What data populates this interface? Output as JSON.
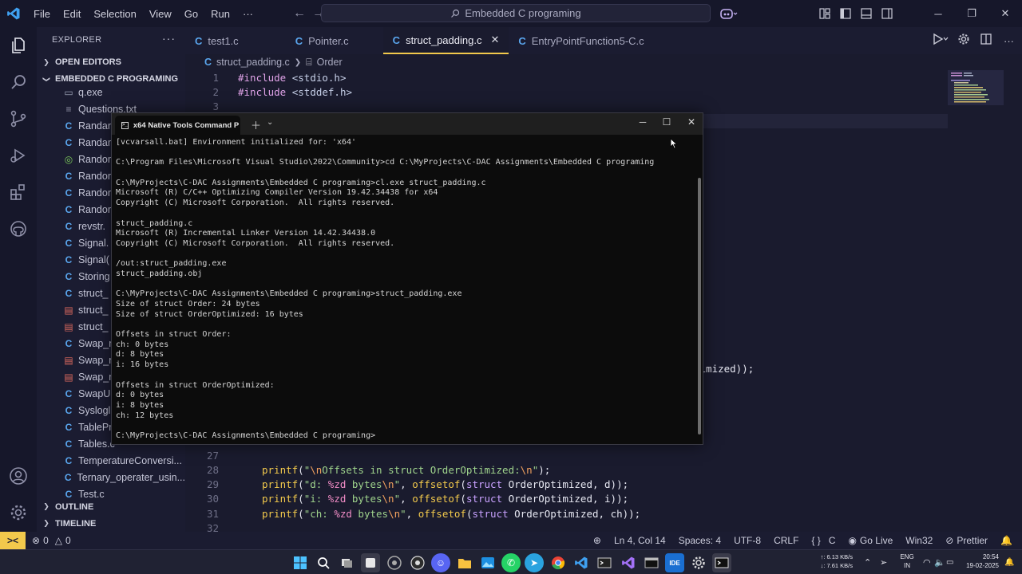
{
  "menu": [
    "File",
    "Edit",
    "Selection",
    "View",
    "Go",
    "Run",
    "···"
  ],
  "search": "Embedded C programing",
  "explorer": {
    "title": "EXPLORER",
    "open_editors": "OPEN EDITORS",
    "folder": "EMBEDDED C PROGRAMING",
    "files": [
      {
        "name": "q.exe",
        "kind": "exe"
      },
      {
        "name": "Questions.txt",
        "kind": "txt"
      },
      {
        "name": "Randar",
        "kind": "c"
      },
      {
        "name": "Randar",
        "kind": "c"
      },
      {
        "name": "Randor",
        "kind": "green"
      },
      {
        "name": "Randor",
        "kind": "c"
      },
      {
        "name": "Randor",
        "kind": "c"
      },
      {
        "name": "Randor",
        "kind": "c"
      },
      {
        "name": "revstr.",
        "kind": "c"
      },
      {
        "name": "Signal.",
        "kind": "c"
      },
      {
        "name": "Signal(",
        "kind": "c"
      },
      {
        "name": "Storing",
        "kind": "c"
      },
      {
        "name": "struct_",
        "kind": "c"
      },
      {
        "name": "struct_",
        "kind": "red"
      },
      {
        "name": "struct_",
        "kind": "red"
      },
      {
        "name": "Swap_n",
        "kind": "c"
      },
      {
        "name": "Swap_n",
        "kind": "red"
      },
      {
        "name": "Swap_n",
        "kind": "red"
      },
      {
        "name": "SwapU",
        "kind": "c"
      },
      {
        "name": "Syslogl",
        "kind": "c"
      },
      {
        "name": "TablePr",
        "kind": "c"
      },
      {
        "name": "Tables.c",
        "kind": "c"
      },
      {
        "name": "TemperatureConversi...",
        "kind": "c"
      },
      {
        "name": "Ternary_operater_usin...",
        "kind": "c"
      },
      {
        "name": "Test.c",
        "kind": "c"
      }
    ],
    "outline": "OUTLINE",
    "timeline": "TIMELINE"
  },
  "tabs": [
    {
      "label": "test1.c",
      "active": false
    },
    {
      "label": "Pointer.c",
      "active": false
    },
    {
      "label": "struct_padding.c",
      "active": true
    },
    {
      "label": "EntryPointFunction5-C.c",
      "active": false
    }
  ],
  "breadcrumb": {
    "file": "struct_padding.c",
    "symbol": "Order"
  },
  "code_top": {
    "l1": "1",
    "l2": "2",
    "l3": "3",
    "inc1": "#include",
    "hdr1": "<stdio.h>",
    "inc2": "#include",
    "hdr2": "<stddef.h>"
  },
  "code_partial": "timized));",
  "code_bottom": {
    "l27": "27",
    "l28": "28",
    "l29": "29",
    "l30": "30",
    "l31": "31",
    "l32": "32"
  },
  "terminal": {
    "tab_title": "x64 Native Tools Command P",
    "lines": [
      "[vcvarsall.bat] Environment initialized for: 'x64'",
      "",
      "C:\\Program Files\\Microsoft Visual Studio\\2022\\Community>cd C:\\MyProjects\\C-DAC Assignments\\Embedded C programing",
      "",
      "C:\\MyProjects\\C-DAC Assignments\\Embedded C programing>cl.exe struct_padding.c",
      "Microsoft (R) C/C++ Optimizing Compiler Version 19.42.34438 for x64",
      "Copyright (C) Microsoft Corporation.  All rights reserved.",
      "",
      "struct_padding.c",
      "Microsoft (R) Incremental Linker Version 14.42.34438.0",
      "Copyright (C) Microsoft Corporation.  All rights reserved.",
      "",
      "/out:struct_padding.exe",
      "struct_padding.obj",
      "",
      "C:\\MyProjects\\C-DAC Assignments\\Embedded C programing>struct_padding.exe",
      "Size of struct Order: 24 bytes",
      "Size of struct OrderOptimized: 16 bytes",
      "",
      "Offsets in struct Order:",
      "ch: 0 bytes",
      "d: 8 bytes",
      "i: 16 bytes",
      "",
      "Offsets in struct OrderOptimized:",
      "d: 0 bytes",
      "i: 8 bytes",
      "ch: 12 bytes",
      "",
      "C:\\MyProjects\\C-DAC Assignments\\Embedded C programing>"
    ]
  },
  "status": {
    "remote": "><",
    "errors": "0",
    "warnings": "0",
    "position": "Ln 4, Col 14",
    "spaces": "Spaces: 4",
    "encoding": "UTF-8",
    "eol": "CRLF",
    "braces": "{ }",
    "language": "C",
    "golive": "Go Live",
    "platform": "Win32",
    "prettier": "Prettier"
  },
  "taskbar": {
    "net_up": "↑: 6.13 KB/s",
    "net_down": "↓: 7.61 KB/s",
    "lang1": "ENG",
    "lang2": "IN",
    "time": "20:54",
    "date": "19-02-2025"
  },
  "colors": {
    "accent": "#f2c94c",
    "c_icon": "#5aa6ee",
    "background": "#1a1b2e"
  }
}
